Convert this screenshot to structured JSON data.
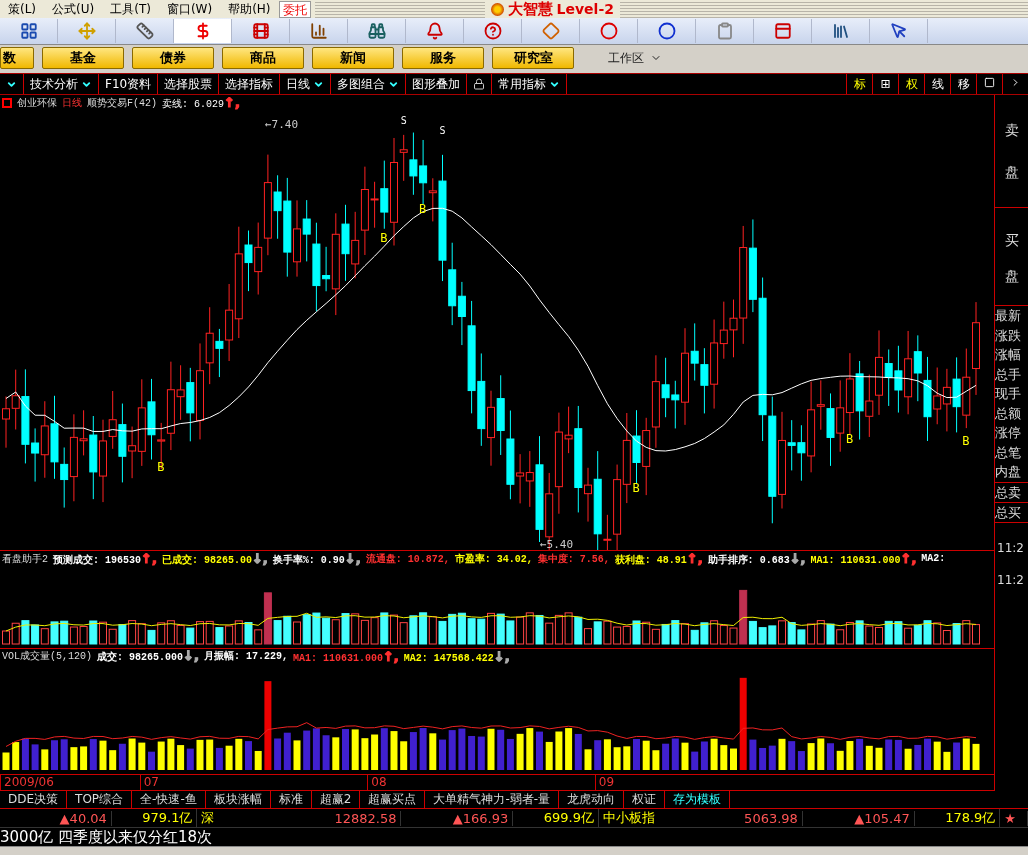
{
  "menu": [
    {
      "label": "策(L)"
    },
    {
      "label": "公式(U)"
    },
    {
      "label": "工具(T)"
    },
    {
      "label": "窗口(W)"
    },
    {
      "label": "帮助(H)"
    }
  ],
  "trade_button": "委托",
  "logo": {
    "brand": "大智慧",
    "edition": "Level-2"
  },
  "toolbar": [
    {
      "kind": "grid",
      "selected": false
    },
    {
      "kind": "move",
      "selected": false
    },
    {
      "kind": "ruler",
      "selected": false
    },
    {
      "kind": "dollar",
      "selected": true
    },
    {
      "kind": "film",
      "selected": false
    },
    {
      "kind": "bars",
      "selected": false
    },
    {
      "kind": "binoculars",
      "selected": false
    },
    {
      "kind": "bell",
      "selected": false
    },
    {
      "kind": "help",
      "selected": false
    },
    {
      "kind": "diamond",
      "selected": false
    },
    {
      "kind": "circle-red",
      "selected": false
    },
    {
      "kind": "circle-blue",
      "selected": false
    },
    {
      "kind": "clipboard",
      "selected": false
    },
    {
      "kind": "window",
      "selected": false
    },
    {
      "kind": "books",
      "selected": false
    },
    {
      "kind": "pointer",
      "selected": false
    }
  ],
  "nav_buttons": [
    "数",
    "基金",
    "债券",
    "商品",
    "新闻",
    "服务",
    "研究室"
  ],
  "workspace": "工作区",
  "tabs": [
    {
      "label": "技术分析",
      "dropdown": true
    },
    {
      "label": "F10资料",
      "dropdown": false
    },
    {
      "label": "选择股票",
      "dropdown": false
    },
    {
      "label": "选择指标",
      "dropdown": false
    },
    {
      "label": "日线",
      "dropdown": true
    },
    {
      "label": "多图组合",
      "dropdown": true
    },
    {
      "label": "图形叠加",
      "dropdown": false
    },
    {
      "label": "常用指标",
      "dropdown": true
    }
  ],
  "right_tools": [
    {
      "label": "标",
      "active": true
    },
    {
      "label": "⊞",
      "active": false
    },
    {
      "label": "权",
      "active": true
    },
    {
      "label": "线",
      "active": false
    },
    {
      "label": "移",
      "active": false
    }
  ],
  "chart": {
    "stock": "创业环保",
    "period": "日线",
    "indicator": "顺势交易F(42)",
    "reading_label": "卖线:",
    "reading": "6.029",
    "arrow": {
      "text": "↑,",
      "color": "#ff3030"
    },
    "high_label": "←7.40",
    "low_label": "←5.40",
    "buy_signals": [
      "B",
      "B",
      "B",
      "B",
      "B",
      "B"
    ],
    "sell_signals": [
      "S",
      "S"
    ]
  },
  "indicator_1": {
    "title": "看盘助手2",
    "fields": [
      {
        "label": "预测成交:",
        "value": "196530",
        "arrow": {
          "text": "↑,",
          "color": "#ff3030"
        },
        "color": "#ffffff"
      },
      {
        "label": "已成交:",
        "value": "98265.00",
        "arrow": {
          "text": "↓,",
          "color": "#aaaaaa"
        },
        "color": "#ffff00"
      },
      {
        "label": "换手率%:",
        "value": "0.90",
        "arrow": {
          "text": "↓,",
          "color": "#aaaaaa"
        },
        "color": "#ffffff"
      },
      {
        "label": "流通盘:",
        "value": "10.872,",
        "color": "#ff3030"
      },
      {
        "label": "市盈率:",
        "value": "34.02,",
        "color": "#ffff00"
      },
      {
        "label": "集中度:",
        "value": "7.56,",
        "color": "#ff3030"
      },
      {
        "label": "获利盘:",
        "value": "48.91",
        "arrow": {
          "text": "↑,",
          "color": "#ff3030"
        },
        "color": "#ffff00"
      },
      {
        "label": "助手排序:",
        "value": "0.683",
        "arrow": {
          "text": "↓,",
          "color": "#aaaaaa"
        },
        "color": "#ffffff"
      },
      {
        "label": "MA1:",
        "value": "110631.000",
        "arrow": {
          "text": "↑,",
          "color": "#ff3030"
        },
        "color": "#ffff00"
      },
      {
        "label": "MA2:",
        "color": "#ffffff"
      }
    ],
    "time_labels": [
      "11:2",
      "11:2"
    ]
  },
  "indicator_2": {
    "title": "VOL成交量(5,120)",
    "fields": [
      {
        "label": "成交:",
        "value": "98265.000",
        "arrow": {
          "text": "↓,",
          "color": "#aaaaaa"
        },
        "color": "#ffffff"
      },
      {
        "label": "月振幅:",
        "value": "17.229,",
        "color": "#ffffff"
      },
      {
        "label": "MA1:",
        "value": "110631.000",
        "arrow": {
          "text": "↑,",
          "color": "#ff3030"
        },
        "color": "#ff3030"
      },
      {
        "label": "MA2:",
        "value": "147568.422",
        "arrow": {
          "text": "↓,",
          "color": "#aaaaaa"
        },
        "color": "#ffff00"
      }
    ]
  },
  "dates": [
    "2009/06",
    "07",
    "08",
    "09"
  ],
  "bottom_tabs": [
    {
      "label": "DDE决策",
      "kind": "tab"
    },
    {
      "label": "TOP综合",
      "kind": "tab"
    },
    {
      "label": "全-快速-鱼",
      "kind": "tab"
    },
    {
      "label": "板块涨幅",
      "kind": "tab"
    },
    {
      "label": "标准",
      "kind": "tab"
    },
    {
      "label": "超赢2",
      "kind": "tab"
    },
    {
      "label": "超赢买点",
      "kind": "tab"
    },
    {
      "label": "大单精气神力-弱者-量",
      "kind": "tab"
    },
    {
      "label": "龙虎动向",
      "kind": "tab"
    },
    {
      "label": "权证",
      "kind": "tab"
    },
    {
      "label": "存为模板",
      "kind": "action"
    }
  ],
  "market_row": [
    {
      "text": "▲40.04",
      "kind": "change"
    },
    {
      "text": "979.1亿",
      "kind": "amount"
    },
    {
      "text": "深",
      "kind": "market"
    },
    {
      "text": "12882.58",
      "kind": "index"
    },
    {
      "text": "▲166.93",
      "kind": "change"
    },
    {
      "text": "699.9亿",
      "kind": "amount"
    },
    {
      "text": "中小板指",
      "kind": "market"
    },
    {
      "text": "5063.98",
      "kind": "index"
    },
    {
      "text": "▲105.47",
      "kind": "change"
    },
    {
      "text": "178.9亿",
      "kind": "amount"
    },
    {
      "text": "★",
      "kind": "star"
    }
  ],
  "ticker": "3000亿 四季度以来仅分红18次",
  "side_panel": {
    "sell": "卖盘",
    "buy": "买盘",
    "fields": [
      "最新",
      "涨跌",
      "涨幅",
      "总手",
      "现手",
      "总额",
      "涨停",
      "总笔",
      "内盘"
    ],
    "totals": [
      "总卖",
      "总买"
    ]
  }
}
